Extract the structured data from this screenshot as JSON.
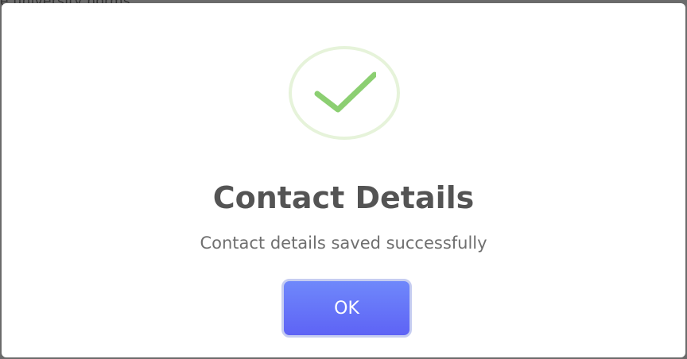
{
  "background": {
    "partial_text": "e university norms"
  },
  "dialog": {
    "icon": "checkmark-icon",
    "title": "Contact Details",
    "message": "Contact details saved successfully",
    "ok_label": "OK"
  },
  "colors": {
    "check": "#8ccf72",
    "ring": "#e6f3da",
    "button_top": "#6f88fb",
    "button_bottom": "#5e63f5",
    "title": "#545454",
    "message": "#6f6f6f"
  }
}
